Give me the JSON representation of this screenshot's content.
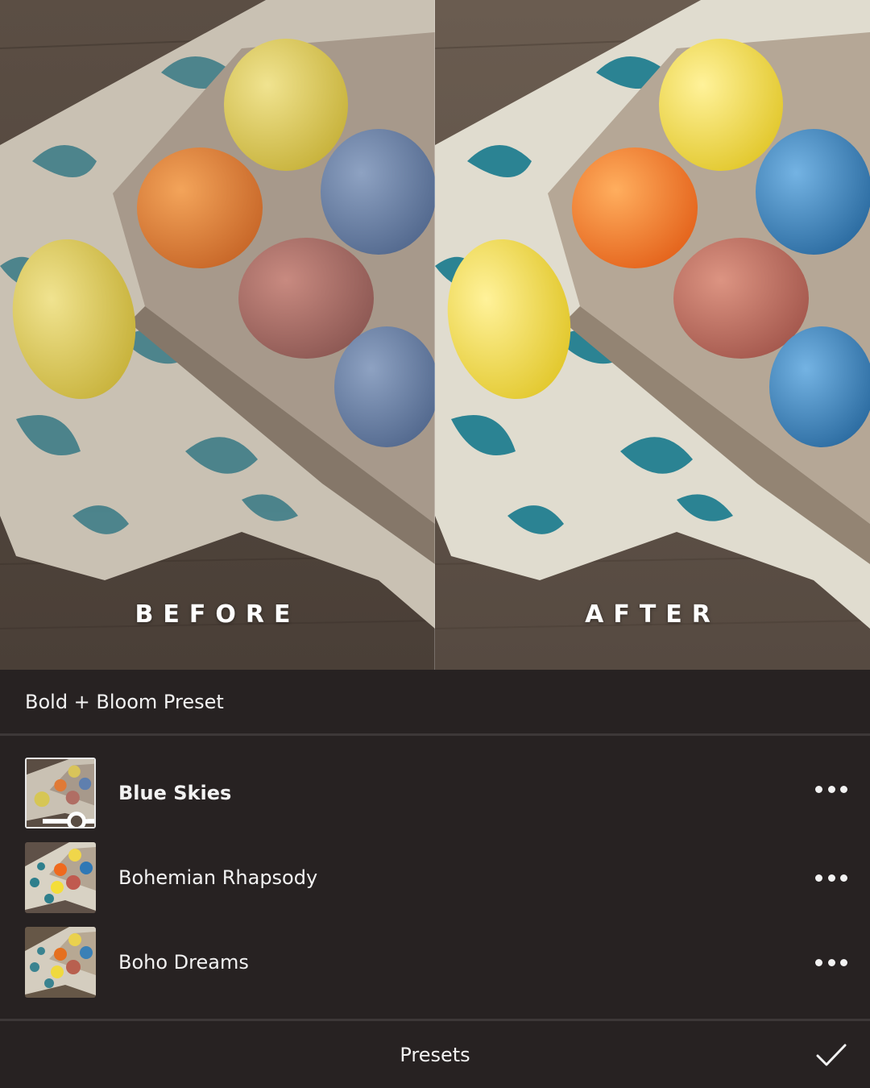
{
  "compare": {
    "before_label": "BEFORE",
    "after_label": "AFTER"
  },
  "group": {
    "title": "Bold + Bloom Preset"
  },
  "presets": [
    {
      "name": "Blue Skies",
      "selected": true
    },
    {
      "name": "Bohemian Rhapsody",
      "selected": false
    },
    {
      "name": "Boho Dreams",
      "selected": false
    }
  ],
  "bottom_bar": {
    "tab_label": "Presets"
  },
  "icons": {
    "more": "more-horizontal-icon",
    "confirm": "checkmark-icon",
    "adjust": "slider-adjust-icon"
  },
  "colors": {
    "panel_bg": "#272222",
    "divider": "#3d3838",
    "text": "#f2f2f2"
  }
}
